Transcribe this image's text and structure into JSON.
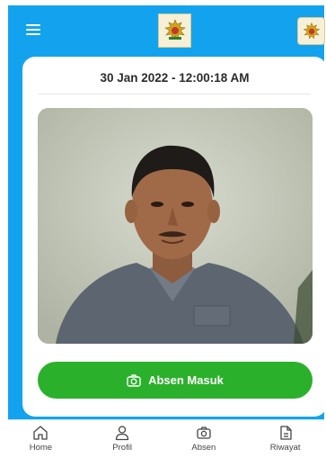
{
  "header": {
    "menu_icon": "hamburger-menu-icon",
    "center_logo": "emblem-logo",
    "right_avatar": "emblem-avatar"
  },
  "card": {
    "datetime": "30 Jan 2022 - 12:00:18 AM",
    "photo": "selfie-photo"
  },
  "action": {
    "label": "Absen Masuk",
    "icon": "camera-icon",
    "color": "#2bb02b"
  },
  "bottom_nav": {
    "items": [
      {
        "label": "Home",
        "icon": "home-icon"
      },
      {
        "label": "Profil",
        "icon": "user-icon"
      },
      {
        "label": "Absen",
        "icon": "camera-icon"
      },
      {
        "label": "Riwayat",
        "icon": "document-icon"
      }
    ]
  },
  "colors": {
    "primary": "#13a3ee",
    "success": "#2bb02b",
    "background": "#ffffff"
  }
}
